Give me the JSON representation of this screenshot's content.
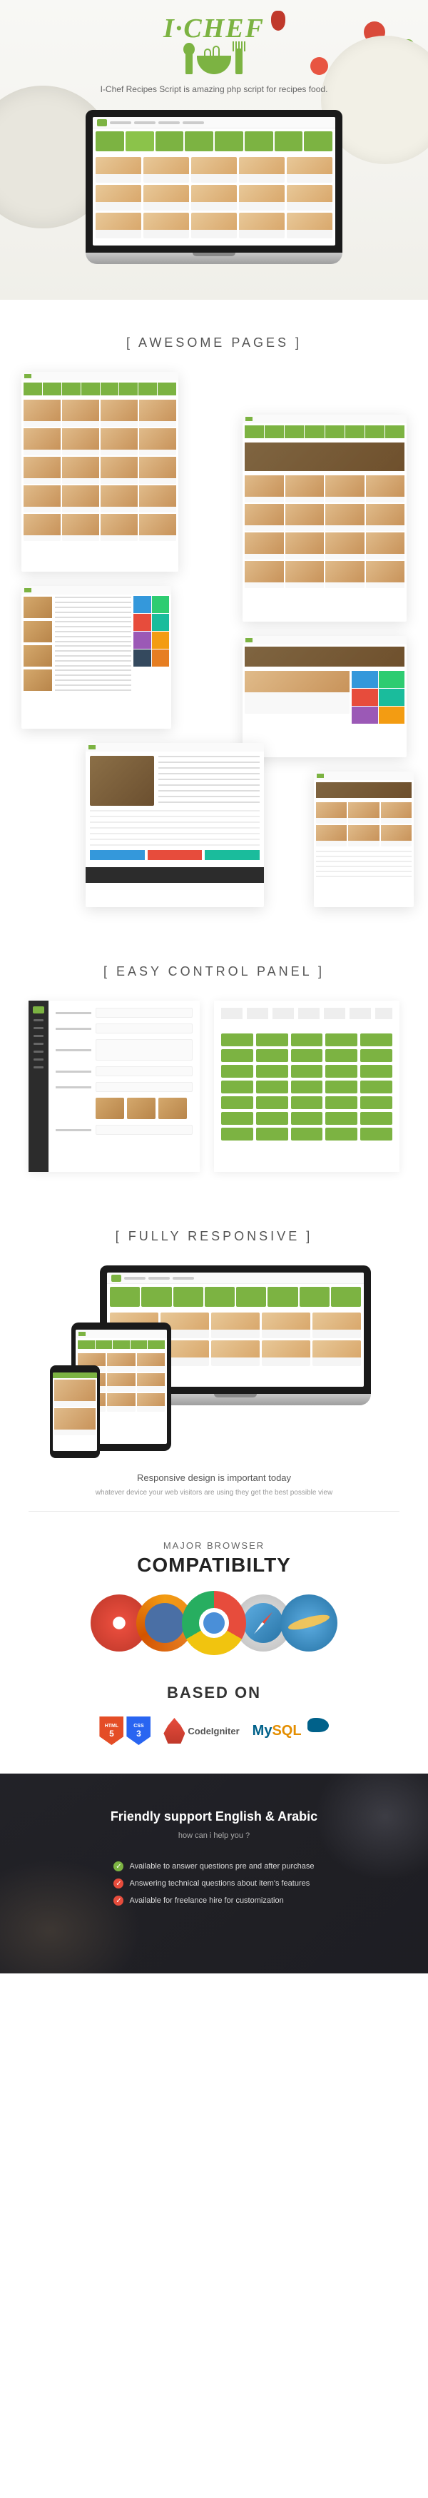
{
  "hero": {
    "logo": "I·CHEF",
    "tagline": "I-Chef Recipes Script is amazing php script for recipes food."
  },
  "sections": {
    "pages": "[  AWESOME PAGES  ]",
    "control": "[  EASY CONTROL PANEL  ]",
    "responsive": "[  FULLY RESPONSIVE  ]"
  },
  "responsive": {
    "title": "Responsive design is important today",
    "subtitle": "whatever device your web visitors are using they get the best possible view"
  },
  "browsers": {
    "major": "MAJOR BROWSER",
    "compat": "COMPATIBILTY",
    "based": "BASED ON"
  },
  "tech": {
    "html5_label": "HTML",
    "html5_num": "5",
    "css3_label": "CSS",
    "css3_num": "3",
    "codeigniter": "CodeIgniter",
    "mysql_my": "My",
    "mysql_sql": "SQL"
  },
  "support": {
    "title": "Friendly support English & Arabic",
    "subtitle": "how can i help you ?",
    "items": [
      "Available to answer questions pre and after purchase",
      "Answering technical questions about item's features",
      "Available for freelance hire for customization"
    ]
  }
}
